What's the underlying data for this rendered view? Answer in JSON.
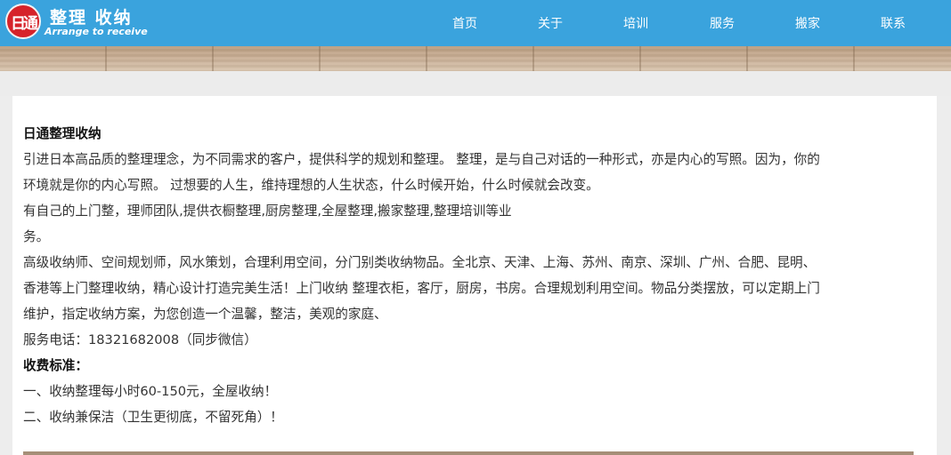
{
  "header": {
    "logo_glyphs": "日通",
    "title": "整理 收纳",
    "subtitle": "Arrange to receive",
    "nav": [
      "首页",
      "关于",
      "培训",
      "服务",
      "搬家",
      "联系"
    ]
  },
  "colors": {
    "header_bg": "#3aa3dd",
    "logo_red": "#d6232a",
    "page_bg": "#ededed",
    "card_bg": "#ffffff",
    "text": "#333333"
  },
  "article": {
    "heading": "日通整理收纳",
    "lines": [
      "引进日本高品质的整理理念，为不同需求的客户，提供科学的规划和整理。 整理，是与自己对话的一种形式，亦是内心的写照。因为，你的",
      "环境就是你的内心写照。 过想要的人生，维持理想的人生状态，什么时候开始，什么时候就会改变。",
      "有自己的上门整，理师团队,提供衣橱整理,厨房整理,全屋整理,搬家整理,整理培训等业",
      "务。",
      "高级收纳师、空间规划师，风水策划，合理利用空间，分门别类收纳物品。全北京、天津、上海、苏州、南京、深圳、广州、合肥、昆明、",
      "香港等上门整理收纳，精心设计打造完美生活！上门收纳 整理衣柜，客厅，厨房，书房。合理规划利用空间。物品分类摆放，可以定期上门",
      "维护，指定收纳方案，为您创造一个温馨，整洁，美观的家庭、"
    ],
    "phone_line": "服务电话：18321682008（同步微信）",
    "fee_heading": "收费标准：",
    "fees": [
      "一、收纳整理每小时60-150元，全屋收纳！",
      "二、收纳兼保洁（卫生更彻底，不留死角）！"
    ]
  }
}
